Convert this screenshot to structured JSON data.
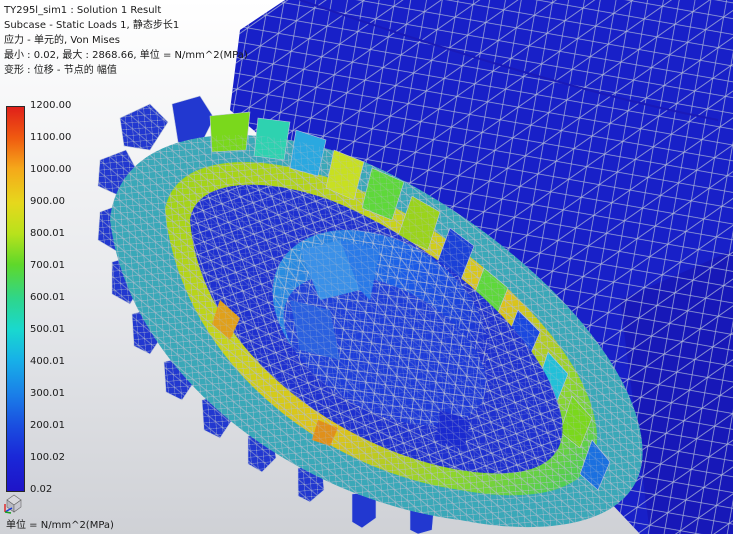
{
  "header": {
    "title": "TY295l_sim1 : Solution 1 Result",
    "subcase": "Subcase - Static Loads 1, 静态步长1",
    "result_type": "应力 - 单元的, Von Mises",
    "range": "最小 : 0.02, 最大 : 2868.66, 单位 = N/mm^2(MPa)",
    "deformation": "变形 : 位移 - 节点的 幅值"
  },
  "legend": {
    "ticks": [
      "1200.00",
      "1100.00",
      "1000.00",
      "900.00",
      "800.01",
      "700.01",
      "600.01",
      "500.01",
      "400.01",
      "300.01",
      "200.01",
      "100.02",
      "0.02"
    ],
    "unit": "单位 = N/mm^2(MPa)"
  },
  "colors": {
    "mesh_blue": "#1820c8",
    "mesh_line": "#b8c0d8",
    "stress_high": "#e0201a",
    "stress_low": "#1e14c8"
  },
  "icons": {
    "triad": "csys-triad-icon"
  }
}
